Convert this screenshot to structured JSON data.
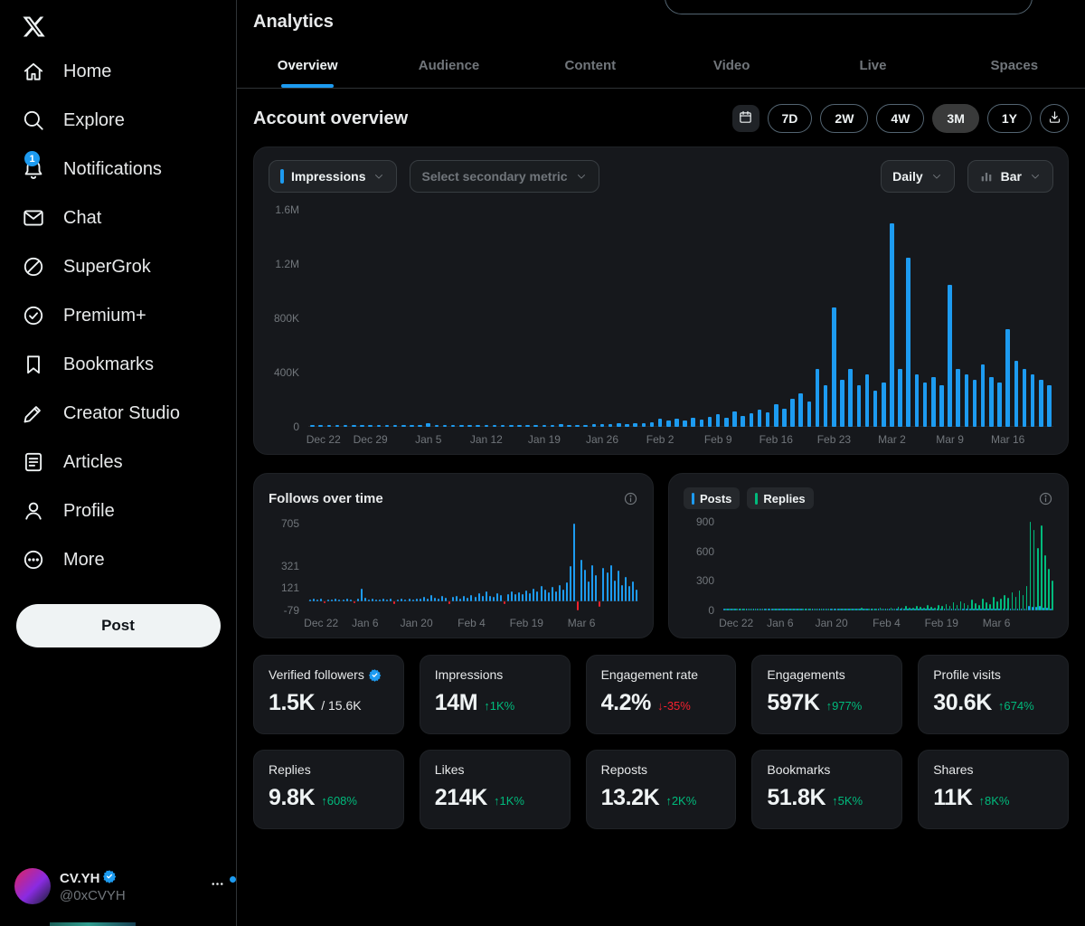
{
  "header": {
    "title": "Analytics"
  },
  "sidebar": {
    "logo_icon": "x-logo-icon",
    "items": [
      {
        "label": "Home",
        "icon": "home-icon"
      },
      {
        "label": "Explore",
        "icon": "search-icon"
      },
      {
        "label": "Notifications",
        "icon": "bell-icon",
        "badge": "1"
      },
      {
        "label": "Chat",
        "icon": "envelope-icon"
      },
      {
        "label": "SuperGrok",
        "icon": "grok-icon"
      },
      {
        "label": "Premium+",
        "icon": "premium-check-icon"
      },
      {
        "label": "Bookmarks",
        "icon": "bookmark-icon"
      },
      {
        "label": "Creator Studio",
        "icon": "pen-icon"
      },
      {
        "label": "Articles",
        "icon": "document-icon"
      },
      {
        "label": "Profile",
        "icon": "person-icon"
      },
      {
        "label": "More",
        "icon": "more-circle-icon"
      }
    ],
    "post_button": "Post",
    "account": {
      "name": "CV.YH",
      "handle": "@0xCVYH",
      "verified": true
    }
  },
  "tabs": {
    "items": [
      "Overview",
      "Audience",
      "Content",
      "Video",
      "Live",
      "Spaces"
    ],
    "active": "Overview"
  },
  "section": {
    "title": "Account overview"
  },
  "range": {
    "options": [
      "7D",
      "2W",
      "4W",
      "3M",
      "1Y"
    ],
    "selected": "3M"
  },
  "chart_controls": {
    "primary_metric": "Impressions",
    "secondary_metric_placeholder": "Select secondary metric",
    "interval": "Daily",
    "chart_type": "Bar"
  },
  "cards": {
    "follows_title": "Follows over time"
  },
  "legend": {
    "posts": "Posts",
    "replies": "Replies"
  },
  "colors": {
    "accent": "#1d9bf0",
    "positive": "#00ba7c",
    "negative": "#f4212e"
  },
  "stats": {
    "rows": [
      [
        {
          "label": "Verified followers",
          "verified_badge": true,
          "value": "1.5K",
          "suffix": "/ 15.6K"
        },
        {
          "label": "Impressions",
          "value": "14M",
          "delta": "1K%",
          "dir": "up"
        },
        {
          "label": "Engagement rate",
          "value": "4.2%",
          "delta": "-35%",
          "dir": "down"
        },
        {
          "label": "Engagements",
          "value": "597K",
          "delta": "977%",
          "dir": "up"
        },
        {
          "label": "Profile visits",
          "value": "30.6K",
          "delta": "674%",
          "dir": "up"
        }
      ],
      [
        {
          "label": "Replies",
          "value": "9.8K",
          "delta": "608%",
          "dir": "up"
        },
        {
          "label": "Likes",
          "value": "214K",
          "delta": "1K%",
          "dir": "up"
        },
        {
          "label": "Reposts",
          "value": "13.2K",
          "delta": "2K%",
          "dir": "up"
        },
        {
          "label": "Bookmarks",
          "value": "51.8K",
          "delta": "5K%",
          "dir": "up"
        },
        {
          "label": "Shares",
          "value": "11K",
          "delta": "8K%",
          "dir": "up"
        }
      ]
    ]
  },
  "chart_data": [
    {
      "id": "impressions",
      "type": "bar",
      "title": "Impressions (Daily)",
      "unit": "thousands",
      "ymin": 0,
      "ymax": 1650,
      "y_ticks": [
        {
          "value": 1600,
          "label": "1.6M"
        },
        {
          "value": 1200,
          "label": "1.2M"
        },
        {
          "value": 800,
          "label": "800K"
        },
        {
          "value": 400,
          "label": "400K"
        },
        {
          "value": 0,
          "label": "0"
        }
      ],
      "x_ticks": [
        {
          "index": 0,
          "label": "Dec 22"
        },
        {
          "index": 7,
          "label": "Dec 29"
        },
        {
          "index": 14,
          "label": "Jan 5"
        },
        {
          "index": 21,
          "label": "Jan 12"
        },
        {
          "index": 28,
          "label": "Jan 19"
        },
        {
          "index": 35,
          "label": "Jan 26"
        },
        {
          "index": 42,
          "label": "Feb 2"
        },
        {
          "index": 49,
          "label": "Feb 9"
        },
        {
          "index": 56,
          "label": "Feb 16"
        },
        {
          "index": 63,
          "label": "Feb 23"
        },
        {
          "index": 70,
          "label": "Mar 2"
        },
        {
          "index": 77,
          "label": "Mar 9"
        },
        {
          "index": 84,
          "label": "Mar 16"
        }
      ],
      "series": [
        {
          "name": "Impressions",
          "color": "#1d9bf0",
          "values": [
            6,
            9,
            7,
            12,
            8,
            10,
            7,
            11,
            9,
            13,
            10,
            8,
            12,
            9,
            28,
            16,
            12,
            10,
            13,
            9,
            11,
            14,
            10,
            12,
            9,
            13,
            11,
            10,
            15,
            12,
            17,
            13,
            16,
            12,
            19,
            22,
            18,
            26,
            22,
            30,
            26,
            34,
            58,
            44,
            62,
            50,
            68,
            54,
            72,
            95,
            70,
            115,
            82,
            98,
            125,
            105,
            170,
            135,
            210,
            250,
            185,
            430,
            310,
            880,
            350,
            430,
            310,
            390,
            270,
            330,
            1500,
            430,
            1250,
            390,
            330,
            370,
            310,
            1050,
            430,
            390,
            350,
            460,
            370,
            330,
            720,
            490,
            430,
            390,
            350,
            310
          ]
        }
      ]
    },
    {
      "id": "follows",
      "type": "bar",
      "title": "Follows over time",
      "unit": "follows",
      "ymin": -79,
      "ymax": 760,
      "y_ticks": [
        {
          "value": 705,
          "label": "705"
        },
        {
          "value": 321,
          "label": "321"
        },
        {
          "value": 121,
          "label": "121"
        },
        {
          "value": -79,
          "label": "-79"
        }
      ],
      "x_ticks": [
        {
          "index": 0,
          "label": "Dec 22"
        },
        {
          "index": 15,
          "label": "Jan 6"
        },
        {
          "index": 29,
          "label": "Jan 20"
        },
        {
          "index": 44,
          "label": "Feb 4"
        },
        {
          "index": 59,
          "label": "Feb 19"
        },
        {
          "index": 74,
          "label": "Mar 6"
        }
      ],
      "series": [
        {
          "name": "Follows",
          "color": "#1d9bf0",
          "negative_color": "#f4212e",
          "values": [
            18,
            25,
            12,
            30,
            -15,
            22,
            16,
            28,
            20,
            14,
            26,
            18,
            -12,
            24,
            120,
            35,
            20,
            28,
            15,
            22,
            30,
            18,
            25,
            -18,
            20,
            28,
            16,
            24,
            20,
            26,
            30,
            45,
            25,
            60,
            35,
            28,
            50,
            32,
            -20,
            40,
            55,
            30,
            48,
            36,
            60,
            40,
            75,
            50,
            90,
            55,
            45,
            80,
            60,
            -25,
            70,
            95,
            65,
            85,
            70,
            100,
            75,
            120,
            90,
            140,
            105,
            85,
            130,
            95,
            150,
            110,
            170,
            320,
            705,
            -79,
            380,
            290,
            180,
            330,
            240,
            -45,
            300,
            260,
            330,
            190,
            280,
            150,
            220,
            140,
            180,
            110
          ]
        }
      ]
    },
    {
      "id": "posts-replies",
      "type": "bar",
      "title": "Posts and Replies",
      "unit": "count",
      "ymin": 0,
      "ymax": 950,
      "y_ticks": [
        {
          "value": 900,
          "label": "900"
        },
        {
          "value": 600,
          "label": "600"
        },
        {
          "value": 300,
          "label": "300"
        },
        {
          "value": 0,
          "label": "0"
        }
      ],
      "x_ticks": [
        {
          "index": 0,
          "label": "Dec 22"
        },
        {
          "index": 15,
          "label": "Jan 6"
        },
        {
          "index": 29,
          "label": "Jan 20"
        },
        {
          "index": 44,
          "label": "Feb 4"
        },
        {
          "index": 59,
          "label": "Feb 19"
        },
        {
          "index": 74,
          "label": "Mar 6"
        }
      ],
      "series": [
        {
          "name": "Posts",
          "color": "#1d9bf0",
          "values": [
            4,
            2,
            5,
            3,
            6,
            2,
            4,
            3,
            5,
            2,
            6,
            3,
            4,
            2,
            8,
            3,
            5,
            2,
            4,
            3,
            6,
            2,
            5,
            3,
            4,
            2,
            6,
            3,
            5,
            2,
            5,
            3,
            7,
            4,
            8,
            3,
            5,
            9,
            4,
            6,
            3,
            8,
            5,
            4,
            7,
            6,
            4,
            9,
            5,
            8,
            6,
            4,
            10,
            6,
            5,
            9,
            7,
            5,
            11,
            8,
            8,
            6,
            12,
            7,
            10,
            8,
            6,
            14,
            9,
            7,
            12,
            10,
            8,
            15,
            10,
            12,
            16,
            12,
            18,
            14,
            20,
            16,
            22,
            45,
            40,
            35,
            48,
            30,
            25,
            20
          ]
        },
        {
          "name": "Replies",
          "color": "#00ba7c",
          "values": [
            5,
            8,
            3,
            10,
            6,
            4,
            9,
            5,
            7,
            12,
            4,
            8,
            6,
            3,
            15,
            7,
            5,
            9,
            4,
            11,
            6,
            8,
            5,
            10,
            7,
            4,
            12,
            6,
            9,
            5,
            14,
            10,
            18,
            12,
            22,
            15,
            11,
            25,
            16,
            12,
            20,
            14,
            28,
            18,
            15,
            30,
            22,
            38,
            26,
            45,
            32,
            24,
            50,
            35,
            28,
            55,
            40,
            30,
            60,
            42,
            65,
            48,
            80,
            58,
            95,
            70,
            55,
            110,
            78,
            60,
            120,
            85,
            65,
            140,
            95,
            120,
            160,
            130,
            180,
            140,
            200,
            160,
            250,
            900,
            820,
            640,
            870,
            560,
            420,
            300
          ]
        }
      ]
    }
  ]
}
